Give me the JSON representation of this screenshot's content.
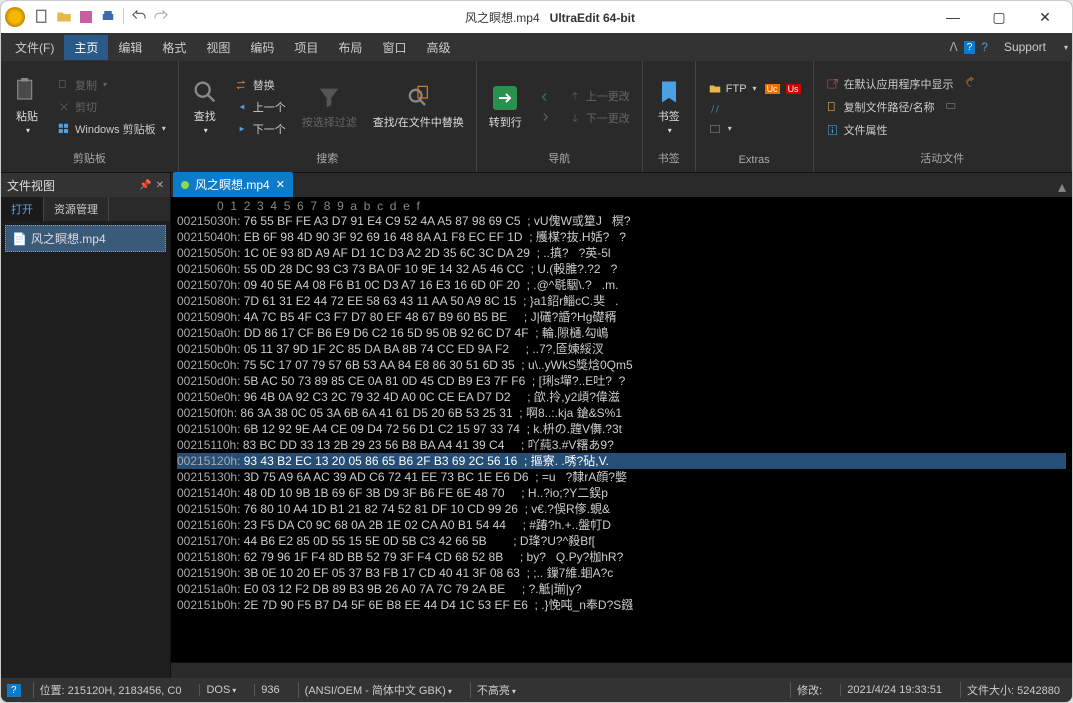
{
  "titlebar": {
    "filename": "风之瞑想.mp4",
    "appname": "UltraEdit 64-bit"
  },
  "menu": {
    "file": "文件(F)",
    "home": "主页",
    "edit": "编辑",
    "format": "格式",
    "view": "视图",
    "encoding": "编码",
    "project": "项目",
    "layout": "布局",
    "window": "窗口",
    "advanced": "高级",
    "support": "Support"
  },
  "ribbon": {
    "clipboard": {
      "paste": "粘贴",
      "copy": "复制",
      "cut": "剪切",
      "windows_clipboard": "Windows 剪贴板",
      "label": "剪贴板"
    },
    "search": {
      "find": "查找",
      "replace": "替换",
      "prev": "上一个",
      "next": "下一个",
      "filter": "按选择过滤",
      "find_in_files": "查找/在文件中替换",
      "label": "搜索"
    },
    "navigate": {
      "goto": "转到行",
      "prev_change": "上一更改",
      "next_change": "下一更改",
      "label": "导航"
    },
    "bookmarks": {
      "bookmark": "书签",
      "label": "书签"
    },
    "extras": {
      "ftp": "FTP",
      "label": "Extras"
    },
    "active_file": {
      "open_default": "在默认应用程序中显示",
      "copy_path": "复制文件路径/名称",
      "properties": "文件属性",
      "label": "活动文件"
    }
  },
  "sidebar": {
    "title": "文件视图",
    "tab_open": "打开",
    "tab_mgr": "资源管理",
    "file": "风之瞑想.mp4"
  },
  "tab": {
    "name": "风之瞑想.mp4"
  },
  "hex": {
    "ruler": "            0  1  2  3  4  5  6  7  8  9  a  b  c  d  e  f",
    "lines": [
      {
        "offset": "00215030h:",
        "hex": "76 55 BF FE A3 D7 91 E4 C9 52 4A A5 87 98 69 C5",
        "ascii": "; vU傀W或篂J   榠?"
      },
      {
        "offset": "00215040h:",
        "hex": "EB 6F 98 4D 90 3F 92 69 16 48 8A A1 F8 EC EF 1D",
        "ascii": "; 雘楳?抜.H姡?   ?"
      },
      {
        "offset": "00215050h:",
        "hex": "1C 0E 93 8D A9 AF D1 1C D3 A2 2D 35 6C 3C DA 29",
        "ascii": "; ..搷?   ?英-5l<?"
      },
      {
        "offset": "00215060h:",
        "hex": "55 0D 28 DC 93 C3 73 BA 0F 10 9E 14 32 A5 46 CC",
        "ascii": "; U.(軗脽?.?2   ?"
      },
      {
        "offset": "00215070h:",
        "hex": "09 40 5E A4 08 F6 B1 0C D3 A7 16 E3 16 6D 0F 20",
        "ascii": "; .@^毼駰\\.?   .m. "
      },
      {
        "offset": "00215080h:",
        "hex": "7D 61 31 E2 44 72 EE 58 63 43 11 AA 50 A9 8C 15",
        "ascii": "; }a1鉊r鯔cC.猆   ."
      },
      {
        "offset": "00215090h:",
        "hex": "4A 7C B5 4F C3 F7 D7 80 EF 48 67 B9 60 B5 BE   ",
        "ascii": "; J|礒?諙?Hg礎稰   "
      },
      {
        "offset": "002150a0h:",
        "hex": "DD 86 17 CF B6 E9 D6 C2 16 5D 95 0B 92 6C D7 4F",
        "ascii": "; 輪.隙樋.勾嶋   "
      },
      {
        "offset": "002150b0h:",
        "hex": "05 11 37 9D 1F 2C 85 DA BA 8B 74 CC ED 9A F2   ",
        "ascii": "; ..7?,匼媡綏汊   "
      },
      {
        "offset": "002150c0h:",
        "hex": "75 5C 17 07 79 57 6B 53 AA 84 E8 86 30 51 6D 35",
        "ascii": "; u\\..yWkS獎焓0Qm5"
      },
      {
        "offset": "002150d0h:",
        "hex": "5B AC 50 73 89 85 CE 0A 81 0D 45 CD B9 E3 7F F6",
        "ascii": "; [琍s墠?..E吐?  ?"
      },
      {
        "offset": "002150e0h:",
        "hex": "96 4B 0A 92 C3 2C 79 32 4D A0 0C CE EA D7 D2   ",
        "ascii": "; 欿.拎,y2頉?偉滋  "
      },
      {
        "offset": "002150f0h:",
        "hex": "86 3A 38 0C 05 3A 6B 6A 41 61 D5 20 6B 53 25 31",
        "ascii": "; 啊8..:.kja 鎗&S%1"
      },
      {
        "offset": "00215100h:",
        "hex": "6B 12 92 9E A4 CE 09 D4 72 56 D1 C2 15 97 33 74",
        "ascii": "; k.枡の.韙V儛.?3t"
      },
      {
        "offset": "00215110h:",
        "hex": "83 BC DD 33 13 2B 29 23 56 B8 BA A4 41 39 C4   ",
        "ascii": "; 吖蒓3.#V糬あ9?   "
      },
      {
        "offset": "00215120h:",
        "hex": "93 43 B2 EC 13 20 05 86 65 B6 2F B3 69 2C 56 16",
        "ascii": "; 摳寮. .唀?砧,V."
      },
      {
        "offset": "00215130h:",
        "hex": "3D 75 A9 6A AC 39 AD C6 72 41 EE 73 BC 1E E6 D6",
        "ascii": "; =u   ?隸rA顔?嫳   "
      },
      {
        "offset": "00215140h:",
        "hex": "48 0D 10 9B 1B 69 6F 3B D9 3F B6 FE 6E 48 70   ",
        "ascii": "; H..?io;?Y二鋘p   "
      },
      {
        "offset": "00215150h:",
        "hex": "76 80 10 A4 1D B1 21 82 74 52 81 DF 10 CD 99 26",
        "ascii": "; v€.?俁R偧.蜆&   "
      },
      {
        "offset": "00215160h:",
        "hex": "23 F5 DA C0 9C 68 0A 2B 1E 02 CA A0 B1 54 44   ",
        "ascii": "; #踳?h.+..盤帄D   "
      },
      {
        "offset": "00215170h:",
        "hex": "44 B6 E2 85 0D 55 15 5E 0D 5B C3 42 66 5B      ",
        "ascii": "; D琒?U?^殺Bf[   "
      },
      {
        "offset": "00215180h:",
        "hex": "62 79 96 1F F4 8D BB 52 79 3F F4 CD 68 52 8B   ",
        "ascii": "; by?   Q.Py?枷hR?"
      },
      {
        "offset": "00215190h:",
        "hex": "3B 0E 10 20 EF 05 37 B3 FB 17 CD 40 41 3F 08 63",
        "ascii": "; ;.. 鏁7維.蛔A?c"
      },
      {
        "offset": "002151a0h:",
        "hex": "E0 03 12 F2 DB 89 B3 9B 26 A0 7A 7C 79 2A BE   ",
        "ascii": "; ?.觝|瑐|y?"
      },
      {
        "offset": "002151b0h:",
        "hex": "2E 7D 90 F5 B7 D4 5F 6E B8 EE 44 D4 1C 53 EF E6",
        "ascii": "; .}悗吨_n奉D?S鏹"
      }
    ],
    "selected_index": 15
  },
  "statusbar": {
    "position": "位置: 215120H, 2183456, C0",
    "format": "DOS",
    "codepage": "936",
    "encoding": "(ANSI/OEM - 简体中文 GBK)",
    "highlight": "不高亮",
    "modified": "修改:",
    "date": "2021/4/24 19:33:51",
    "filesize_label": "文件大小:",
    "filesize": "5242880"
  }
}
